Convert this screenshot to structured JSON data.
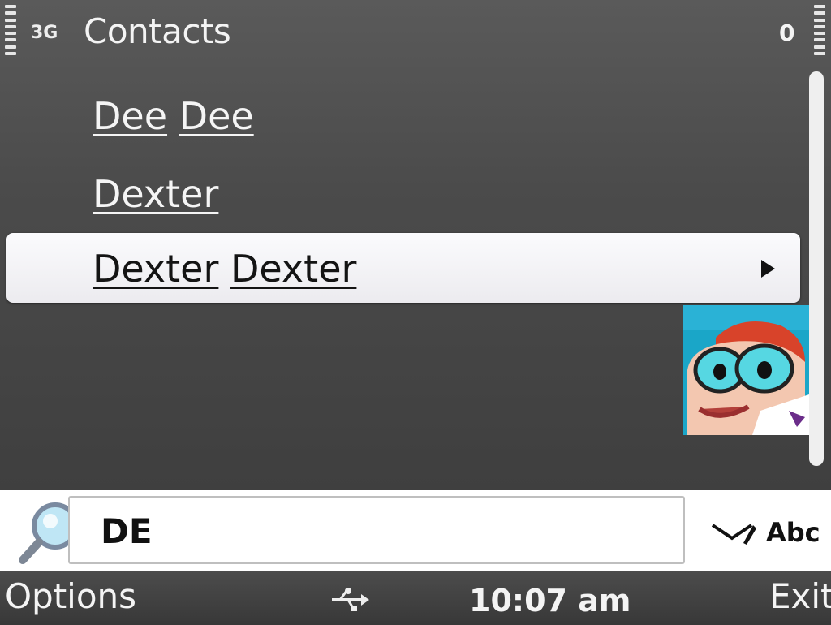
{
  "status_bar": {
    "network": "3G",
    "app_title": "Contacts",
    "counter": "0"
  },
  "contacts": [
    {
      "name_first": "Dee",
      "name_last": "Dee",
      "selected": false
    },
    {
      "name_first": "Dexter",
      "name_last": "",
      "selected": false
    },
    {
      "name_first": "Dexter",
      "name_last": "Dexter",
      "selected": true
    }
  ],
  "search": {
    "value": "DE",
    "input_mode": "Abc",
    "icon": "magnifier-icon"
  },
  "softkeys": {
    "left": "Options",
    "right": "Exit",
    "time": "10:07 am",
    "connectivity_icon": "usb-icon"
  },
  "colors": {
    "background": "#4a4a4a",
    "highlight": "#f2f1f4",
    "search_bar": "#ffffff",
    "text_light": "#f5f5f5",
    "text_dark": "#141414"
  }
}
